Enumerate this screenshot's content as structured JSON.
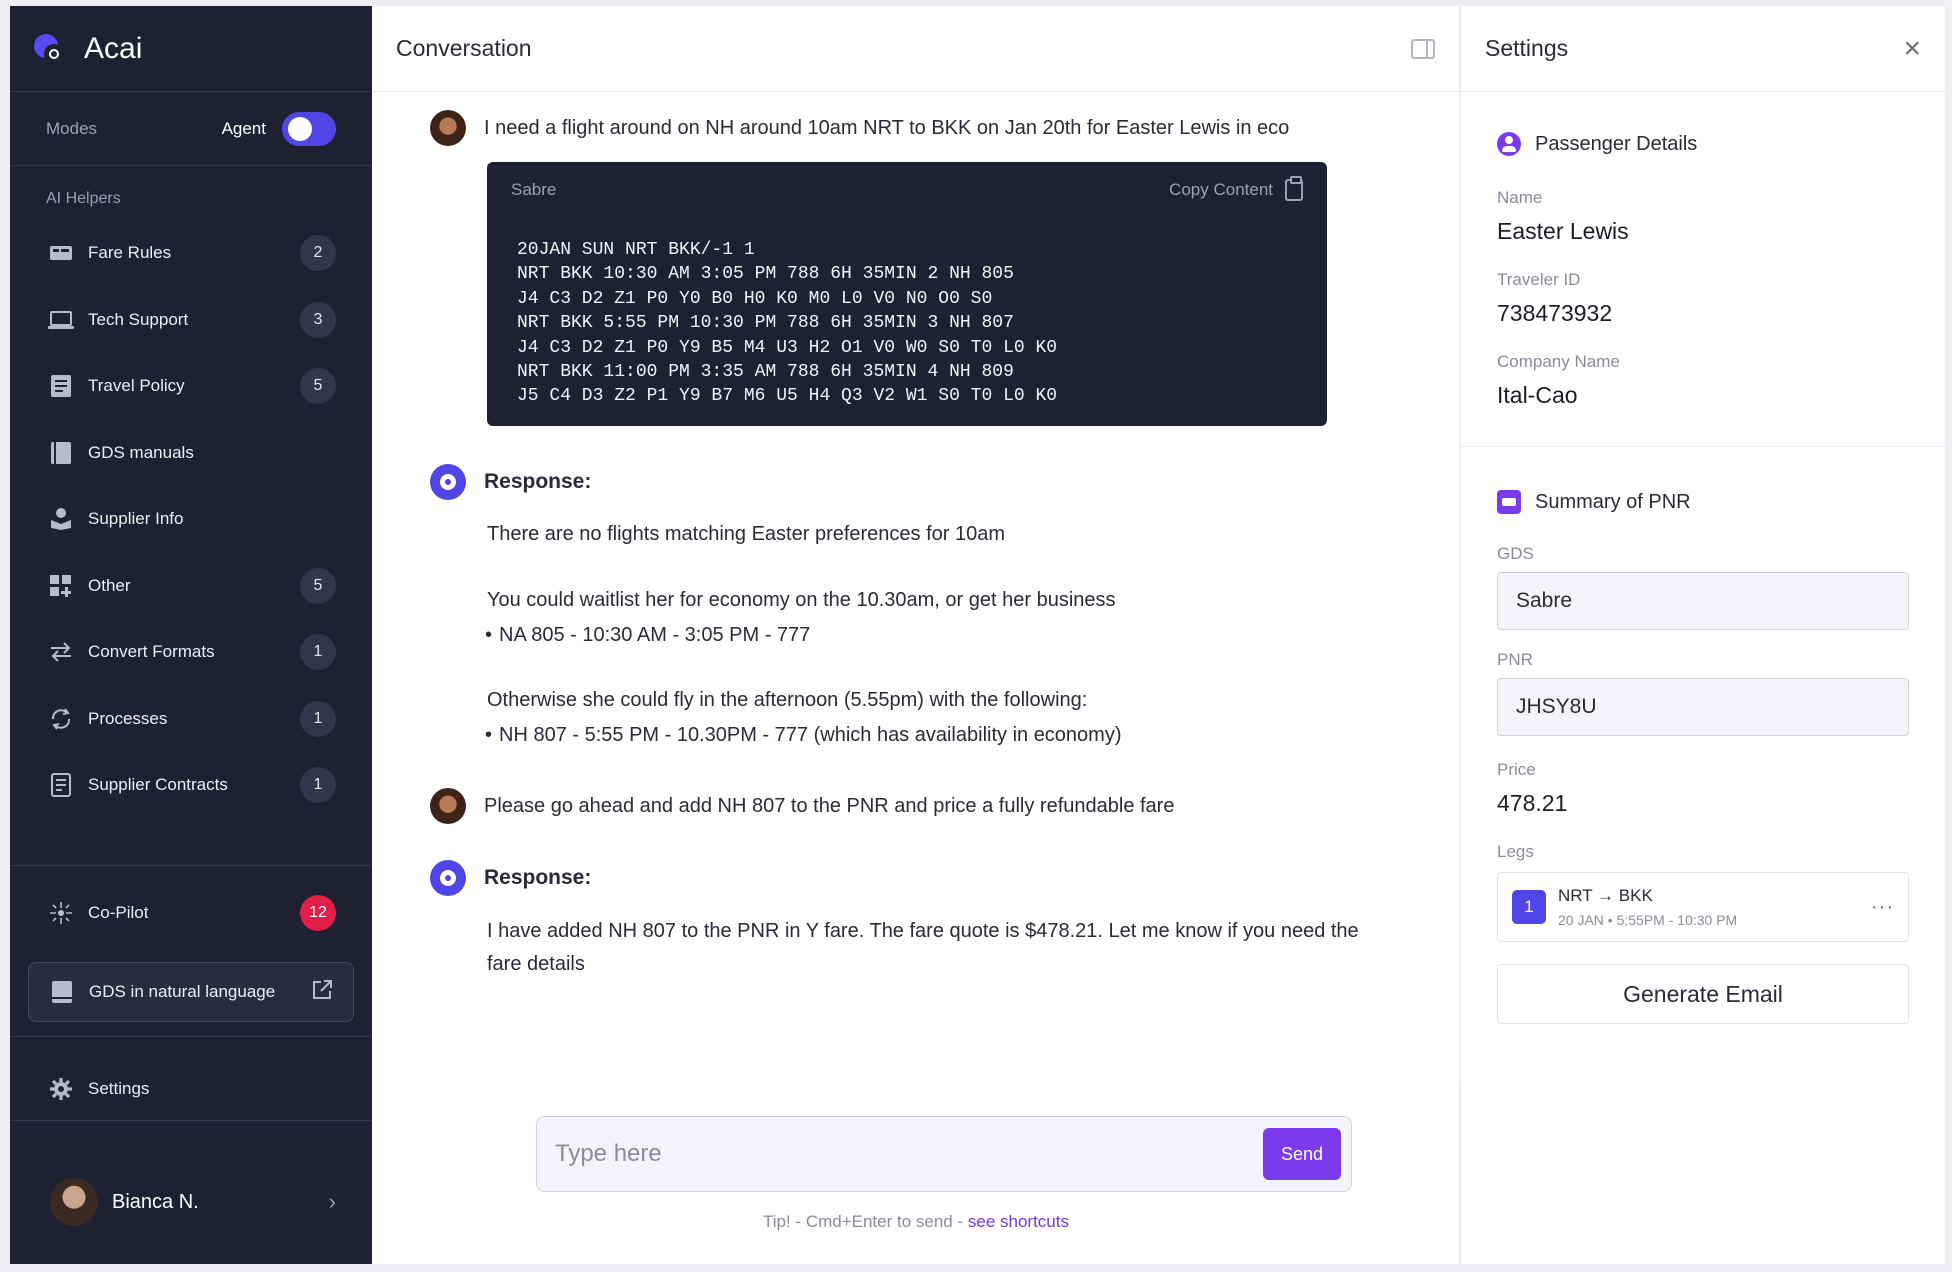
{
  "app": {
    "name": "Acai"
  },
  "modes": {
    "label": "Modes",
    "value": "Agent",
    "enabled": true
  },
  "helpers": {
    "title": "AI Helpers",
    "items": [
      {
        "label": "Fare Rules",
        "count": "2",
        "icon": "fare-rules-icon"
      },
      {
        "label": "Tech Support",
        "count": "3",
        "icon": "laptop-icon"
      },
      {
        "label": "Travel Policy",
        "count": "5",
        "icon": "document-icon"
      },
      {
        "label": "GDS manuals",
        "count": "",
        "icon": "book-icon"
      },
      {
        "label": "Supplier Info",
        "count": "",
        "icon": "supplier-icon"
      },
      {
        "label": "Other",
        "count": "5",
        "icon": "grid-add-icon"
      },
      {
        "label": "Convert Formats",
        "count": "1",
        "icon": "swap-arrows-icon"
      },
      {
        "label": "Processes",
        "count": "1",
        "icon": "cycle-icon"
      },
      {
        "label": "Supplier Contracts",
        "count": "1",
        "icon": "contract-icon"
      }
    ]
  },
  "copilot": {
    "label": "Co-Pilot",
    "count": "12"
  },
  "gds_link": {
    "label": "GDS in natural language"
  },
  "settings_nav": {
    "label": "Settings"
  },
  "user": {
    "name": "Bianca N."
  },
  "conversation": {
    "title": "Conversation",
    "msg1": "I need a flight around on NH around 10am NRT to BKK on Jan 20th for Easter Lewis in eco",
    "code": {
      "lang": "Sabre",
      "copy_label": "Copy Content",
      "lines": [
        "20JAN SUN NRT BKK/-1 1",
        "NRT BKK 10:30 AM 3:05 PM 788 6H 35MIN 2 NH 805",
        "J4 C3 D2 Z1 P0 Y0 B0 H0 K0 M0 L0 V0 N0 O0 S0",
        "NRT BKK 5:55 PM 10:30 PM 788 6H 35MIN 3 NH 807",
        "J4 C3 D2 Z1 P0 Y9 B5 M4 U3 H2 O1 V0 W0 S0 T0 L0 K0",
        "NRT BKK 11:00 PM 3:35 AM 788 6H 35MIN 4 NH 809",
        "J5 C4 D3 Z2 P1 Y9 B7 M6 U5 H4 Q3 V2 W1 S0 T0 L0 K0"
      ]
    },
    "response_label": "Response:",
    "resp1": {
      "line1": "There are no flights matching Easter preferences for 10am",
      "line2": "You could waitlist her for economy on the 10.30am, or get her business",
      "bullet1": "NA 805 - 10:30 AM - 3:05 PM - 777",
      "line3": "Otherwise she could fly in the afternoon (5.55pm) with the following:",
      "bullet2": "NH 807 - 5:55 PM - 10.30PM - 777 (which has availability in economy)"
    },
    "msg2": "Please go ahead and add NH 807 to the PNR and price a fully refundable fare",
    "resp2": {
      "line1": "I have added NH 807 to the PNR in Y fare. The fare quote is $478.21. Let me know if you need the",
      "line2": "fare details"
    },
    "input_placeholder": "Type here",
    "send_label": "Send",
    "tip_prefix": "Tip! - Cmd+Enter to send - ",
    "tip_link": "see shortcuts"
  },
  "settings": {
    "title": "Settings",
    "passenger": {
      "title": "Passenger Details",
      "name_label": "Name",
      "name": "Easter Lewis",
      "traveler_label": "Traveler ID",
      "traveler_id": "738473932",
      "company_label": "Company Name",
      "company": "Ital-Cao"
    },
    "pnr": {
      "title": "Summary of PNR",
      "gds_label": "GDS",
      "gds": "Sabre",
      "pnr_label": "PNR",
      "pnr": "JHSY8U",
      "price_label": "Price",
      "price": "478.21",
      "legs_label": "Legs",
      "leg": {
        "num": "1",
        "route": "NRT → BKK",
        "time": "20 JAN • 5:55PM - 10:30 PM"
      }
    },
    "generate_label": "Generate Email"
  },
  "colors": {
    "sidebar": "#1f2031",
    "accent": "#4f46e5",
    "purple": "#7c3aed",
    "alert": "#e11d48"
  }
}
